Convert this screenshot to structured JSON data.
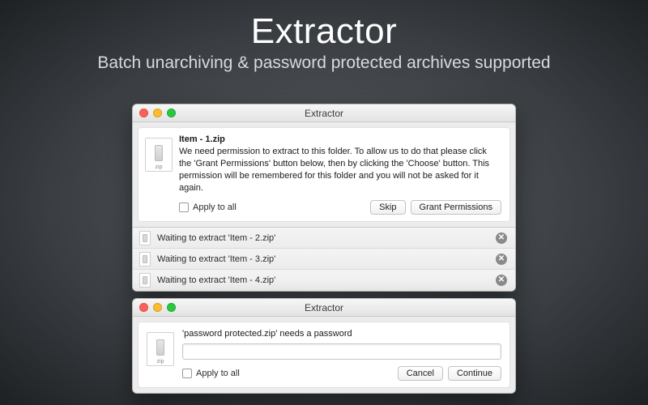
{
  "hero": {
    "title": "Extractor",
    "subtitle": "Batch unarchiving & password protected archives supported"
  },
  "window1": {
    "title": "Extractor",
    "item_title": "Item - 1.zip",
    "description": "We need permission to extract to this folder. To allow us to do that please click the 'Grant Permissions' button below, then by clicking the 'Choose' button. This permission will be remembered for this folder and you will not be asked for it again.",
    "apply_label": "Apply to all",
    "skip_label": "Skip",
    "grant_label": "Grant Permissions",
    "queue": [
      "Waiting to extract 'Item - 2.zip'",
      "Waiting to extract 'Item - 3.zip'",
      "Waiting to extract 'Item - 4.zip'"
    ]
  },
  "window2": {
    "title": "Extractor",
    "prompt": "'password protected.zip' needs a password",
    "apply_label": "Apply to all",
    "cancel_label": "Cancel",
    "continue_label": "Continue"
  }
}
